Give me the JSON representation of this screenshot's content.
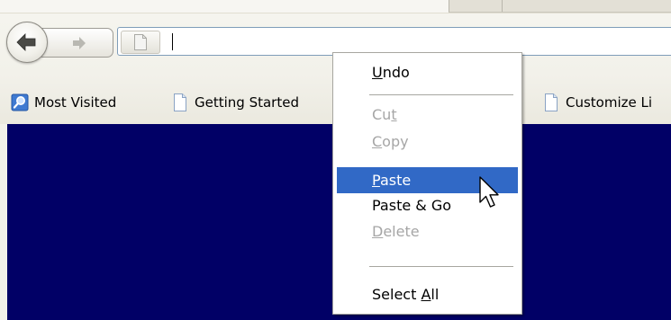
{
  "toolbar": {
    "back_icon": "back-arrow-icon",
    "forward_icon": "forward-arrow-icon",
    "site_identity_icon": "page-icon",
    "url_value": ""
  },
  "bookmarks": [
    {
      "label": "Most Visited",
      "icon": "magnifier-globe-icon"
    },
    {
      "label": "Getting Started",
      "icon": "page-icon"
    },
    {
      "label": "Customize Li",
      "icon": "page-icon"
    }
  ],
  "context_menu": {
    "undo": {
      "label_pre": "",
      "accel": "U",
      "label_post": "ndo"
    },
    "cut": {
      "label_pre": "Cu",
      "accel": "t",
      "label_post": ""
    },
    "copy": {
      "label_pre": "",
      "accel": "C",
      "label_post": "opy"
    },
    "paste": {
      "label_pre": "",
      "accel": "P",
      "label_post": "aste"
    },
    "paste_go": {
      "label": "Paste & Go"
    },
    "delete": {
      "label_pre": "",
      "accel": "D",
      "label_post": "elete"
    },
    "select_all": {
      "label_pre": "Select ",
      "accel": "A",
      "label_post": "ll"
    }
  },
  "colors": {
    "content_background": "#010066",
    "menu_highlight": "#3169c6",
    "disabled_text": "#a6a6a6"
  }
}
